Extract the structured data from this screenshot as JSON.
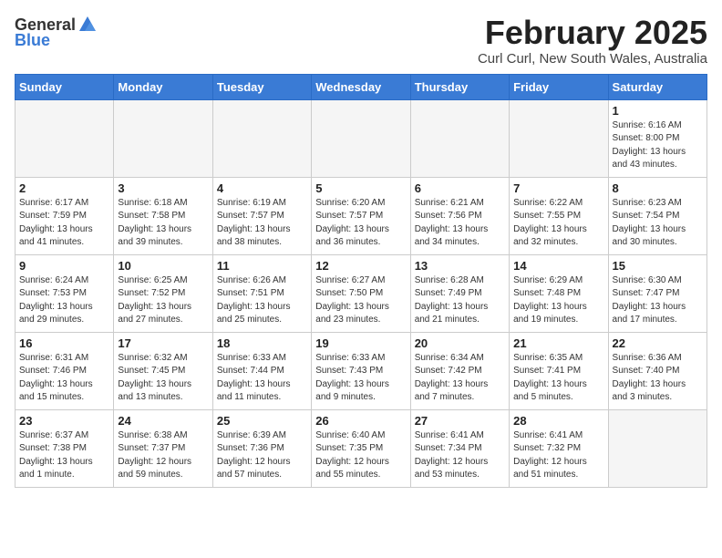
{
  "header": {
    "logo_general": "General",
    "logo_blue": "Blue",
    "title": "February 2025",
    "subtitle": "Curl Curl, New South Wales, Australia"
  },
  "days_of_week": [
    "Sunday",
    "Monday",
    "Tuesday",
    "Wednesday",
    "Thursday",
    "Friday",
    "Saturday"
  ],
  "weeks": [
    [
      {
        "day": "",
        "info": ""
      },
      {
        "day": "",
        "info": ""
      },
      {
        "day": "",
        "info": ""
      },
      {
        "day": "",
        "info": ""
      },
      {
        "day": "",
        "info": ""
      },
      {
        "day": "",
        "info": ""
      },
      {
        "day": "1",
        "info": "Sunrise: 6:16 AM\nSunset: 8:00 PM\nDaylight: 13 hours\nand 43 minutes."
      }
    ],
    [
      {
        "day": "2",
        "info": "Sunrise: 6:17 AM\nSunset: 7:59 PM\nDaylight: 13 hours\nand 41 minutes."
      },
      {
        "day": "3",
        "info": "Sunrise: 6:18 AM\nSunset: 7:58 PM\nDaylight: 13 hours\nand 39 minutes."
      },
      {
        "day": "4",
        "info": "Sunrise: 6:19 AM\nSunset: 7:57 PM\nDaylight: 13 hours\nand 38 minutes."
      },
      {
        "day": "5",
        "info": "Sunrise: 6:20 AM\nSunset: 7:57 PM\nDaylight: 13 hours\nand 36 minutes."
      },
      {
        "day": "6",
        "info": "Sunrise: 6:21 AM\nSunset: 7:56 PM\nDaylight: 13 hours\nand 34 minutes."
      },
      {
        "day": "7",
        "info": "Sunrise: 6:22 AM\nSunset: 7:55 PM\nDaylight: 13 hours\nand 32 minutes."
      },
      {
        "day": "8",
        "info": "Sunrise: 6:23 AM\nSunset: 7:54 PM\nDaylight: 13 hours\nand 30 minutes."
      }
    ],
    [
      {
        "day": "9",
        "info": "Sunrise: 6:24 AM\nSunset: 7:53 PM\nDaylight: 13 hours\nand 29 minutes."
      },
      {
        "day": "10",
        "info": "Sunrise: 6:25 AM\nSunset: 7:52 PM\nDaylight: 13 hours\nand 27 minutes."
      },
      {
        "day": "11",
        "info": "Sunrise: 6:26 AM\nSunset: 7:51 PM\nDaylight: 13 hours\nand 25 minutes."
      },
      {
        "day": "12",
        "info": "Sunrise: 6:27 AM\nSunset: 7:50 PM\nDaylight: 13 hours\nand 23 minutes."
      },
      {
        "day": "13",
        "info": "Sunrise: 6:28 AM\nSunset: 7:49 PM\nDaylight: 13 hours\nand 21 minutes."
      },
      {
        "day": "14",
        "info": "Sunrise: 6:29 AM\nSunset: 7:48 PM\nDaylight: 13 hours\nand 19 minutes."
      },
      {
        "day": "15",
        "info": "Sunrise: 6:30 AM\nSunset: 7:47 PM\nDaylight: 13 hours\nand 17 minutes."
      }
    ],
    [
      {
        "day": "16",
        "info": "Sunrise: 6:31 AM\nSunset: 7:46 PM\nDaylight: 13 hours\nand 15 minutes."
      },
      {
        "day": "17",
        "info": "Sunrise: 6:32 AM\nSunset: 7:45 PM\nDaylight: 13 hours\nand 13 minutes."
      },
      {
        "day": "18",
        "info": "Sunrise: 6:33 AM\nSunset: 7:44 PM\nDaylight: 13 hours\nand 11 minutes."
      },
      {
        "day": "19",
        "info": "Sunrise: 6:33 AM\nSunset: 7:43 PM\nDaylight: 13 hours\nand 9 minutes."
      },
      {
        "day": "20",
        "info": "Sunrise: 6:34 AM\nSunset: 7:42 PM\nDaylight: 13 hours\nand 7 minutes."
      },
      {
        "day": "21",
        "info": "Sunrise: 6:35 AM\nSunset: 7:41 PM\nDaylight: 13 hours\nand 5 minutes."
      },
      {
        "day": "22",
        "info": "Sunrise: 6:36 AM\nSunset: 7:40 PM\nDaylight: 13 hours\nand 3 minutes."
      }
    ],
    [
      {
        "day": "23",
        "info": "Sunrise: 6:37 AM\nSunset: 7:38 PM\nDaylight: 13 hours\nand 1 minute."
      },
      {
        "day": "24",
        "info": "Sunrise: 6:38 AM\nSunset: 7:37 PM\nDaylight: 12 hours\nand 59 minutes."
      },
      {
        "day": "25",
        "info": "Sunrise: 6:39 AM\nSunset: 7:36 PM\nDaylight: 12 hours\nand 57 minutes."
      },
      {
        "day": "26",
        "info": "Sunrise: 6:40 AM\nSunset: 7:35 PM\nDaylight: 12 hours\nand 55 minutes."
      },
      {
        "day": "27",
        "info": "Sunrise: 6:41 AM\nSunset: 7:34 PM\nDaylight: 12 hours\nand 53 minutes."
      },
      {
        "day": "28",
        "info": "Sunrise: 6:41 AM\nSunset: 7:32 PM\nDaylight: 12 hours\nand 51 minutes."
      },
      {
        "day": "",
        "info": ""
      }
    ]
  ]
}
